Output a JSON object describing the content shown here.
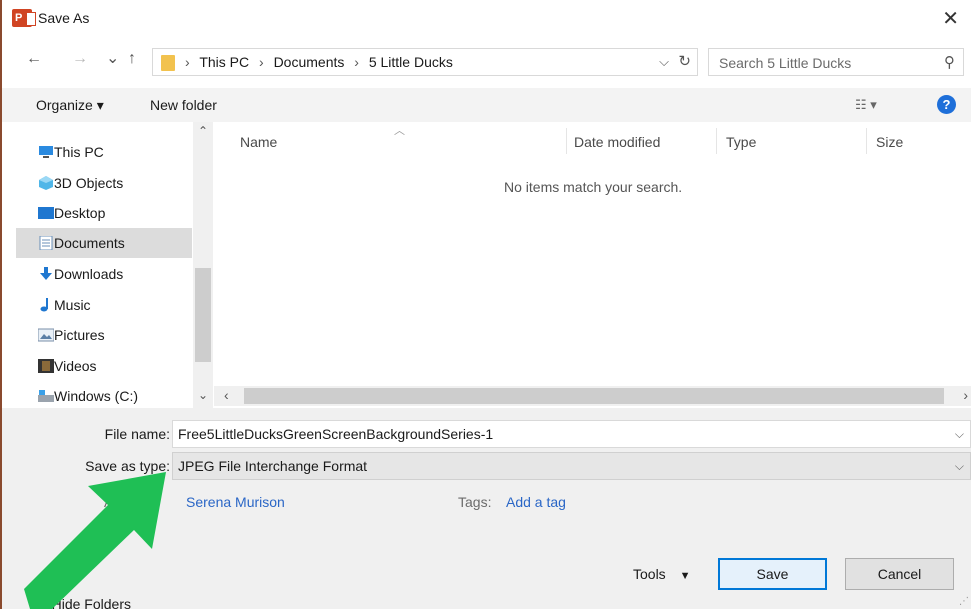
{
  "window": {
    "title": "Save As",
    "app_icon_letter": "P"
  },
  "nav": {
    "back": "←",
    "forward": "→",
    "recent": "⌄",
    "up": "↑"
  },
  "breadcrumb": [
    "This PC",
    "Documents",
    "5 Little Ducks"
  ],
  "search": {
    "placeholder": "Search 5 Little Ducks"
  },
  "toolbar": {
    "organize": "Organize ▾",
    "new_folder": "New folder",
    "help": "?"
  },
  "sidebar": {
    "items": [
      {
        "label": "This PC",
        "icon": "computer-icon"
      },
      {
        "label": "3D Objects",
        "icon": "cube-icon"
      },
      {
        "label": "Desktop",
        "icon": "desktop-icon"
      },
      {
        "label": "Documents",
        "icon": "document-icon",
        "selected": true
      },
      {
        "label": "Downloads",
        "icon": "download-icon"
      },
      {
        "label": "Music",
        "icon": "music-note-icon"
      },
      {
        "label": "Pictures",
        "icon": "picture-icon"
      },
      {
        "label": "Videos",
        "icon": "film-icon"
      },
      {
        "label": "Windows (C:)",
        "icon": "drive-icon"
      }
    ]
  },
  "columns": [
    "Name",
    "Date modified",
    "Type",
    "Size"
  ],
  "empty_message": "No items match your search.",
  "form": {
    "file_name_label": "File name:",
    "file_name": "Free5LittleDucksGreenScreenBackgroundSeries-1",
    "save_type_label": "Save as type:",
    "save_type": "JPEG File Interchange Format",
    "authors_label": "Authors:",
    "authors": "Serena Murison",
    "tags_label": "Tags:",
    "tags": "Add a tag"
  },
  "footer": {
    "hide_folders": "Hide Folders",
    "tools": "Tools",
    "save": "Save",
    "cancel": "Cancel"
  },
  "colors": {
    "accent": "#0078d7",
    "link": "#2a66c6",
    "arrow": "#1fbf55"
  }
}
